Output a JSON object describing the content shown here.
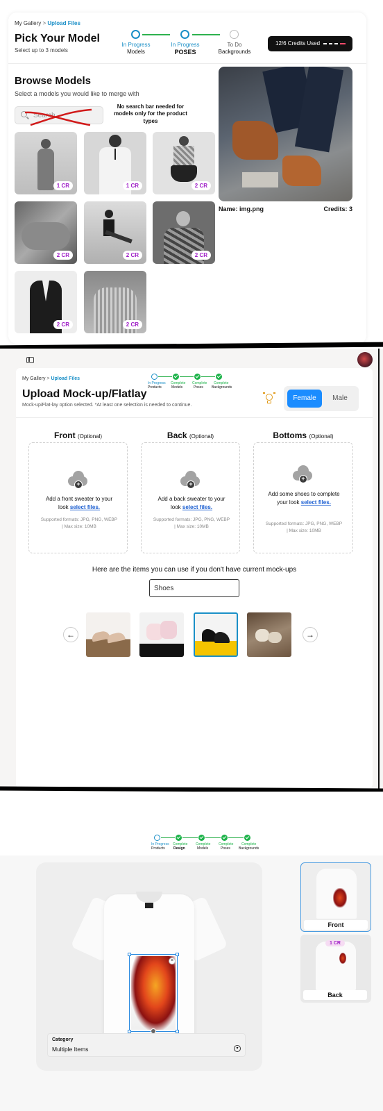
{
  "section1": {
    "breadcrumb": {
      "root": "My Gallery",
      "sep": ">",
      "current": "Upload Files"
    },
    "title": "Pick Your Model",
    "subtitle": "Select up to 3 models",
    "steps": [
      {
        "status": "In Progress",
        "name": "Models",
        "state": "progress"
      },
      {
        "status": "In Progress",
        "name": "POSES",
        "state": "progress"
      },
      {
        "status": "To Do",
        "name": "Backgrounds",
        "state": "todo"
      }
    ],
    "credits_label": "12/6 Credits Used",
    "browse_title": "Browse Models",
    "browse_subtitle": "Select a models you would like to merge with",
    "search_placeholder": "Search",
    "annotation": "No search bar needed for models only for the product types",
    "models": [
      {
        "badge": "1 CR"
      },
      {
        "badge": "1 CR"
      },
      {
        "badge": "2 CR"
      },
      {
        "badge": "2 CR"
      },
      {
        "badge": "2 CR"
      },
      {
        "badge": "2 CR"
      },
      {
        "badge": "2 CR"
      },
      {
        "badge": "2 CR"
      }
    ],
    "preview_name": "Name: img.png",
    "preview_credits": "Credits: 3"
  },
  "section2": {
    "breadcrumb": {
      "root": "My Gallery",
      "sep": ">",
      "current": "Upload Files"
    },
    "mini_steps": [
      {
        "status": "In Progress",
        "name": "Products"
      },
      {
        "status": "Complete",
        "name": "Models"
      },
      {
        "status": "Complete",
        "name": "Poses"
      },
      {
        "status": "Complete",
        "name": "Backgrounds"
      }
    ],
    "title": "Upload Mock-up/Flatlay",
    "subtitle": "Mock-up/Flat-lay option selected. *At least one selection is needed to continue.",
    "gender": {
      "female": "Female",
      "male": "Male",
      "selected": "Female"
    },
    "uploads": [
      {
        "title": "Front",
        "optional": "(Optional)",
        "line1": "Add a front sweater to your look",
        "link": "select files.",
        "formats": "Supported formats: JPG, PNG, WEBP | Max size: 10MB"
      },
      {
        "title": "Back",
        "optional": "(Optional)",
        "line1": "Add a back sweater to your look",
        "link": "select files.",
        "formats": "Supported formats: JPG, PNG, WEBP | Max size: 10MB"
      },
      {
        "title": "Bottoms",
        "optional": "(Optional)",
        "line1": "Add some shoes to complete your look",
        "link": "select files.",
        "formats": "Supported formats: JPG, PNG, WEBP | Max size: 10MB"
      }
    ],
    "items_heading": "Here are the items you can use if you don't have current mock-ups",
    "category_value": "Shoes",
    "carousel_selected_index": 2
  },
  "section3": {
    "mini_steps": [
      {
        "status": "In Progress",
        "name": "Products"
      },
      {
        "status": "Complete",
        "name": "Design"
      },
      {
        "status": "Complete",
        "name": "Models"
      },
      {
        "status": "Complete",
        "name": "Poses"
      },
      {
        "status": "Complete",
        "name": "Backgrounds"
      }
    ],
    "category_label": "Category",
    "category_value": "Multiple Items",
    "views": [
      {
        "label": "Front",
        "selected": true
      },
      {
        "label": "Back",
        "badge": "1 CR",
        "selected": false
      }
    ]
  }
}
